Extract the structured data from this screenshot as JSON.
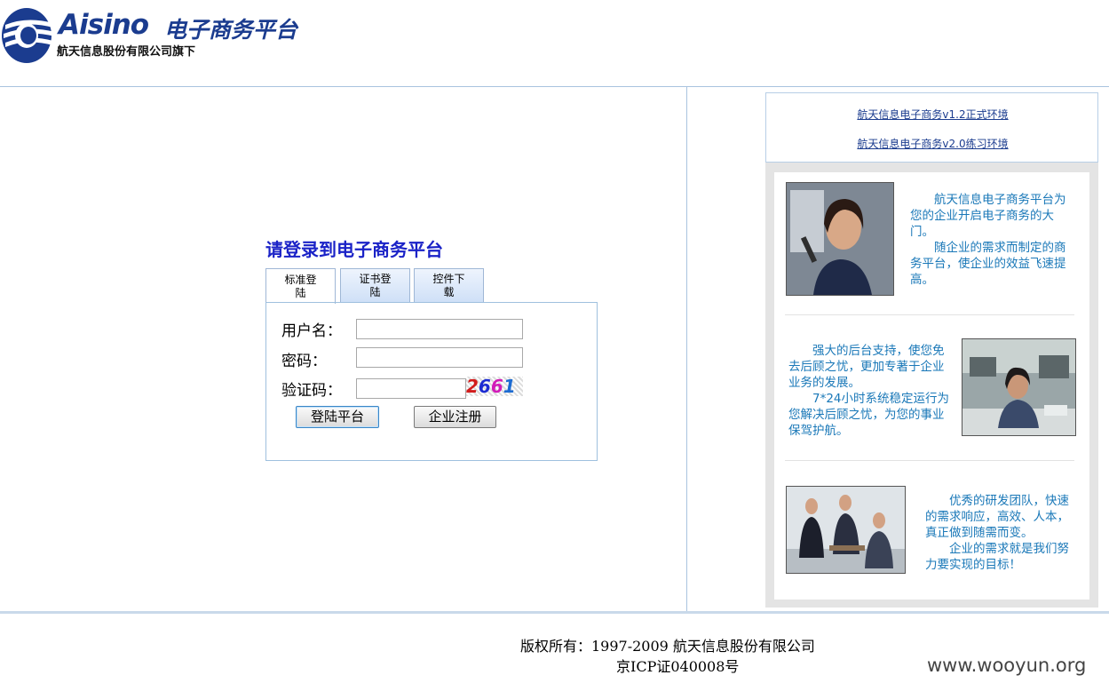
{
  "header": {
    "brand": "Aisino",
    "brand_cn": "电子商务平台",
    "subtitle": "航天信息股份有限公司旗下",
    "logo_icon": "aisino-swoosh-icon"
  },
  "login": {
    "title": "请登录到电子商务平台",
    "tabs": [
      {
        "label": "标准登陆",
        "active": true
      },
      {
        "label": "证书登陆",
        "active": false
      },
      {
        "label": "控件下载",
        "active": false
      }
    ],
    "username_label": "用户名：",
    "password_label": "密码：",
    "captcha_label": "验证码：",
    "captcha_digits": [
      "2",
      "6",
      "6",
      "1"
    ],
    "login_button": "登陆平台",
    "register_button": "企业注册"
  },
  "environments": {
    "link1": "航天信息电子商务v1.2正式环境",
    "link2": "航天信息电子商务v2.0练习环境"
  },
  "promo": [
    {
      "line1": "　　航天信息电子商务平台为您的企业开启电子商务的大门。",
      "line2": "　　随企业的需求而制定的商务平台，使企业的效益飞速提高。",
      "photo": "businesswoman-phone-photo"
    },
    {
      "line1": "　　强大的后台支持，使您免去后顾之忧，更加专著于企业业务的发展。",
      "line2": "　　7*24小时系统稳定运行为您解决后顾之忧，为您的事业保驾护航。",
      "photo": "call-center-operator-photo"
    },
    {
      "line1": "　　优秀的研发团队，快速的需求响应，高效、人本，真正做到随需而变。",
      "line2": "　　企业的需求就是我们努力要实现的目标！",
      "photo": "business-meeting-photo"
    }
  ],
  "footer": {
    "copyright": "版权所有：1997-2009 航天信息股份有限公司",
    "icp": "京ICP证040008号",
    "watermark": "www.wooyun.org"
  },
  "colors": {
    "brand_blue": "#1b3c8f",
    "title_blue": "#1a22c7",
    "promo_text": "#1a78b8",
    "divider": "#a9c3df"
  }
}
